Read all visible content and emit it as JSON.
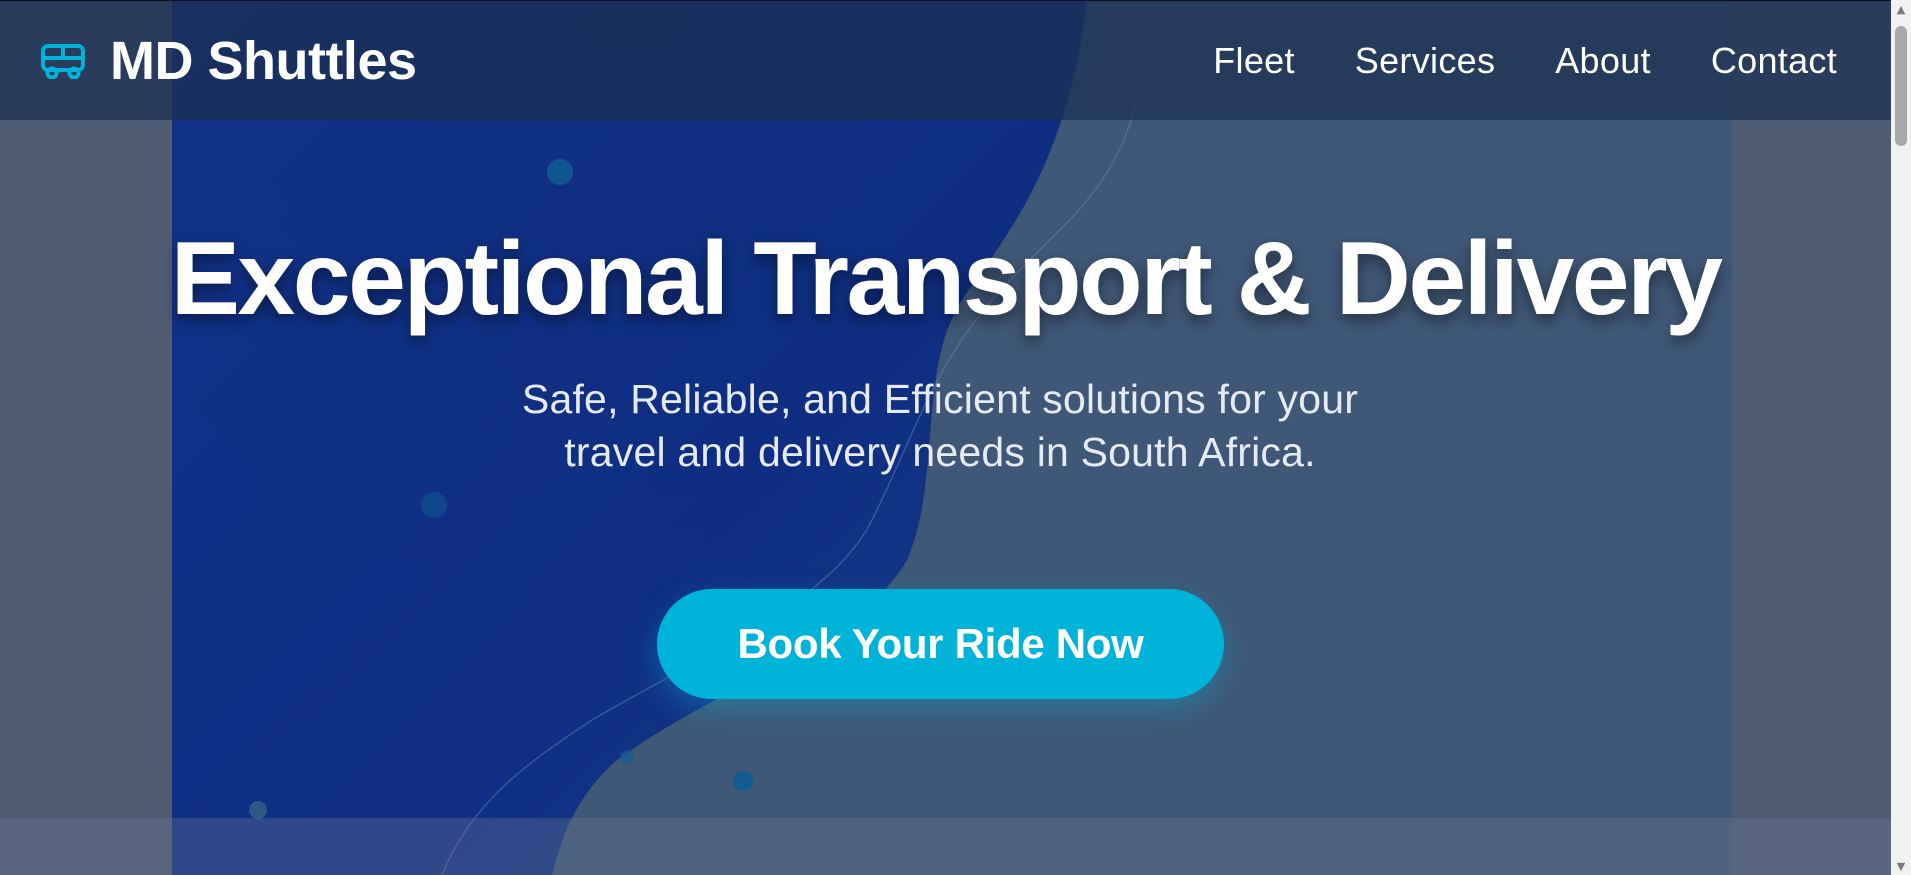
{
  "header": {
    "brand_icon": "bus-icon",
    "brand_name": "MD Shuttles",
    "nav": [
      "Fleet",
      "Services",
      "About",
      "Contact"
    ]
  },
  "hero": {
    "title": "Exceptional Transport & Delivery",
    "subtitle": "Safe, Reliable, and Efficient solutions for your travel and delivery needs in South Africa.",
    "cta_label": "Book Your Ride Now"
  },
  "colors": {
    "accent": "#00b3d9",
    "header_bg": "#1c3052",
    "hero_blue": "#0b2a8a",
    "page_bg": "#505d74"
  },
  "scrollbar": {
    "up_icon": "arrow-up-icon",
    "down_icon": "arrow-down-icon"
  }
}
